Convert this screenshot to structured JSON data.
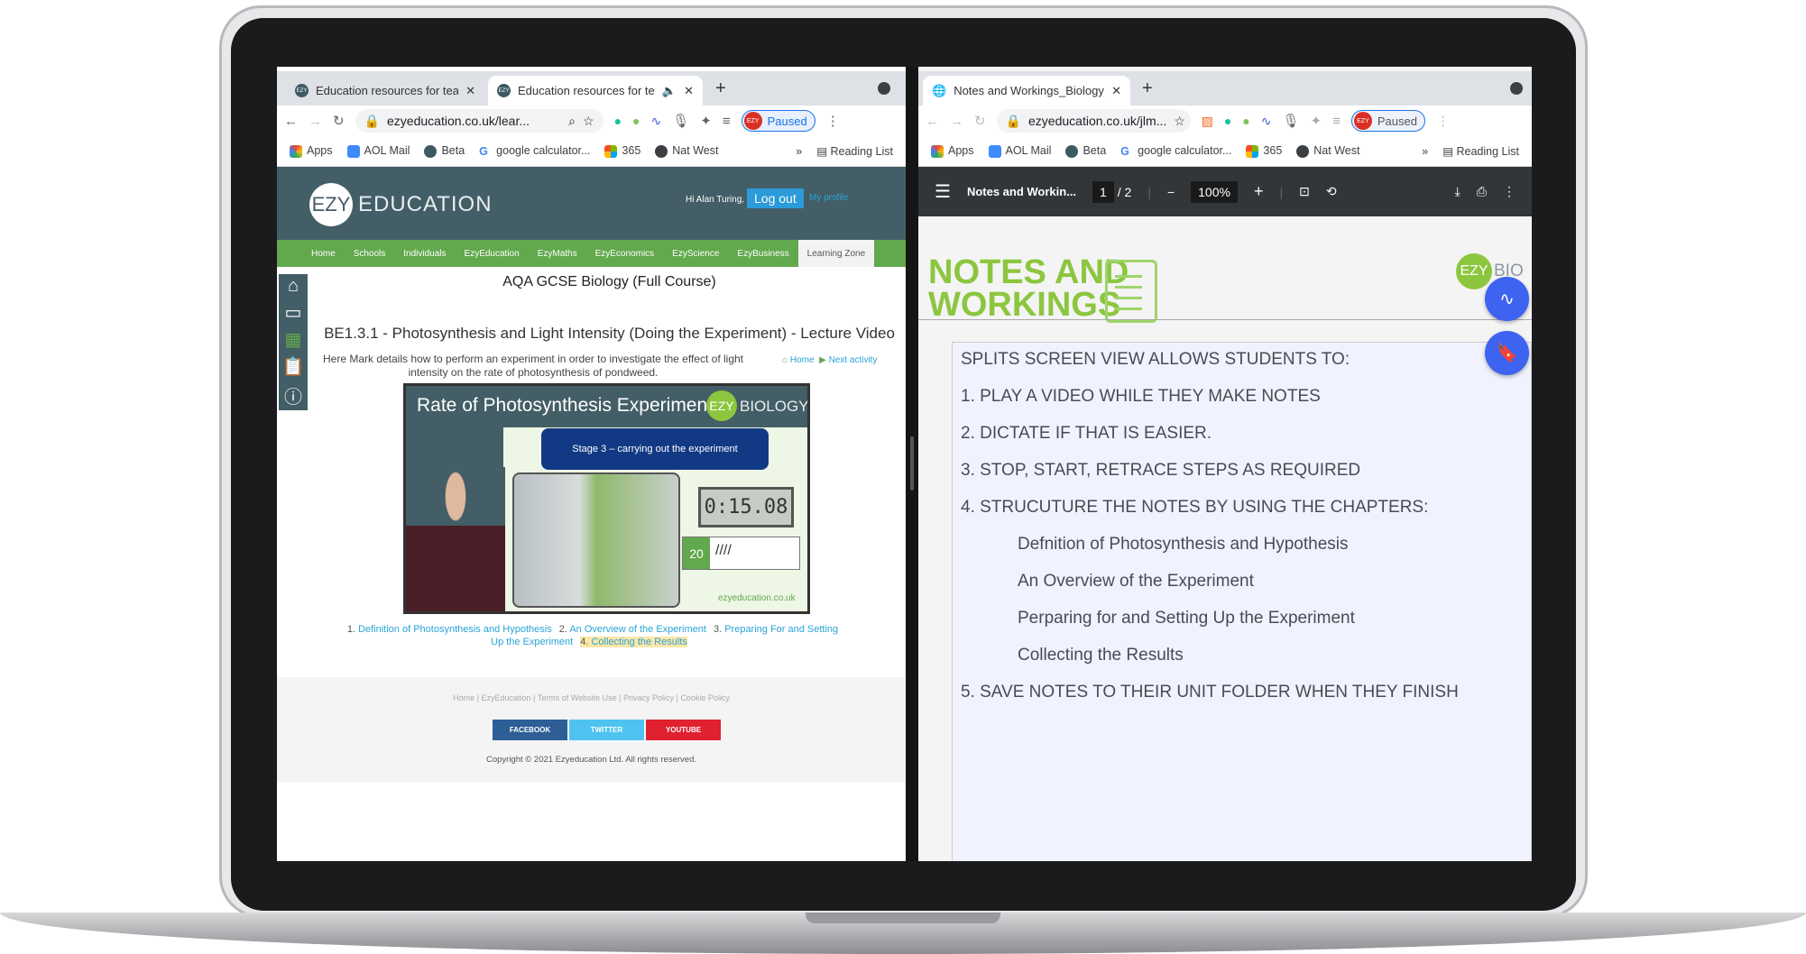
{
  "left": {
    "tabs": [
      {
        "title": "Education resources for teache",
        "active": false
      },
      {
        "title": "Education resources for tea",
        "active": true
      }
    ],
    "url": "ezyeducation.co.uk/lear...",
    "profile": {
      "badge": "EZY",
      "label": "Paused"
    },
    "bookmarks": [
      "Apps",
      "AOL Mail",
      "Beta",
      "google calculator...",
      "365",
      "Nat West"
    ],
    "reading_list": "Reading List",
    "site": {
      "logo": "EZY",
      "logo_text": "EDUCATION",
      "greeting": "Hi Alan Turing,",
      "logout": "Log out",
      "profile": "My profile"
    },
    "nav": [
      "Home",
      "Schools",
      "Individuals",
      "EzyEducation",
      "EzyMaths",
      "EzyEconomics",
      "EzyScience",
      "EzyBusiness",
      "Learning Zone"
    ],
    "nav_selected": "Learning Zone",
    "course_title": "AQA GCSE Biology (Full Course)",
    "lecture_title": "BE1.3.1 - Photosynthesis and Light Intensity (Doing the Experiment) - Lecture Video",
    "description": "Here Mark details how to perform an experiment in order to investigate the effect of light intensity on the rate of photosynthesis of pondweed.",
    "home_link": "Home",
    "next_link": "Next activity",
    "video": {
      "title": "Rate of Photosynthesis Experiment",
      "badge": "EZY",
      "brand": "BIOLOGY",
      "stage": "Stage 3 – carrying out the experiment",
      "timer": "0:15.08",
      "count": "20",
      "tally": "////",
      "site": "ezyeducation.co.uk"
    },
    "chapters": [
      {
        "num": "1.",
        "label": "Definition of Photosynthesis and Hypothesis"
      },
      {
        "num": "2.",
        "label": "An Overview of the Experiment"
      },
      {
        "num": "3.",
        "label": "Preparing For and Setting Up the Experiment"
      },
      {
        "num": "4.",
        "label": "Collecting the Results",
        "active": true
      }
    ],
    "footer": {
      "links": [
        "Home",
        "EzyEducation",
        "Terms of Website Use",
        "Privacy Policy",
        "Cookie Policy"
      ],
      "social": [
        "FACEBOOK",
        "TWITTER",
        "YOUTUBE"
      ],
      "copyright": "Copyright © 2021 Ezyeducation Ltd. All rights reserved."
    }
  },
  "right": {
    "tab": "Notes and Workings_Biology_N",
    "url": "ezyeducation.co.uk/jlm...",
    "profile": {
      "badge": "EZY",
      "label": "Paused"
    },
    "bookmarks": [
      "Apps",
      "AOL Mail",
      "Beta",
      "google calculator...",
      "365",
      "Nat West"
    ],
    "reading_list": "Reading List",
    "pdf": {
      "title": "Notes and Workin...",
      "page": "1",
      "total": "/  2",
      "zoom": "100%"
    },
    "heading_line1": "NOTES AND",
    "heading_line2": "WORKINGS",
    "badge": "EZY",
    "brand": "BIO",
    "notes": [
      "SPLITS SCREEN VIEW ALLOWS STUDENTS TO:",
      "1. PLAY A VIDEO WHILE THEY MAKE NOTES",
      "2. DICTATE IF THAT IS EASIER.",
      "3. STOP, START, RETRACE STEPS AS REQUIRED",
      "4. STRUCUTURE THE NOTES BY USING THE CHAPTERS:"
    ],
    "subnotes": [
      "Defnition of Photosynthesis and Hypothesis",
      "An Overview of the Experiment",
      "Perparing for and Setting Up the Experiment",
      "Collecting the Results"
    ],
    "final_note": "5. SAVE NOTES TO THEIR UNIT FOLDER WHEN THEY FINISH"
  },
  "colors": {
    "ezy_green": "#8cc63f",
    "header": "#435e66",
    "nav_green": "#62a84d",
    "fab_blue": "#3d63f0",
    "facebook": "#2d5e96",
    "twitter": "#4fc3f0",
    "youtube": "#e0212f"
  }
}
